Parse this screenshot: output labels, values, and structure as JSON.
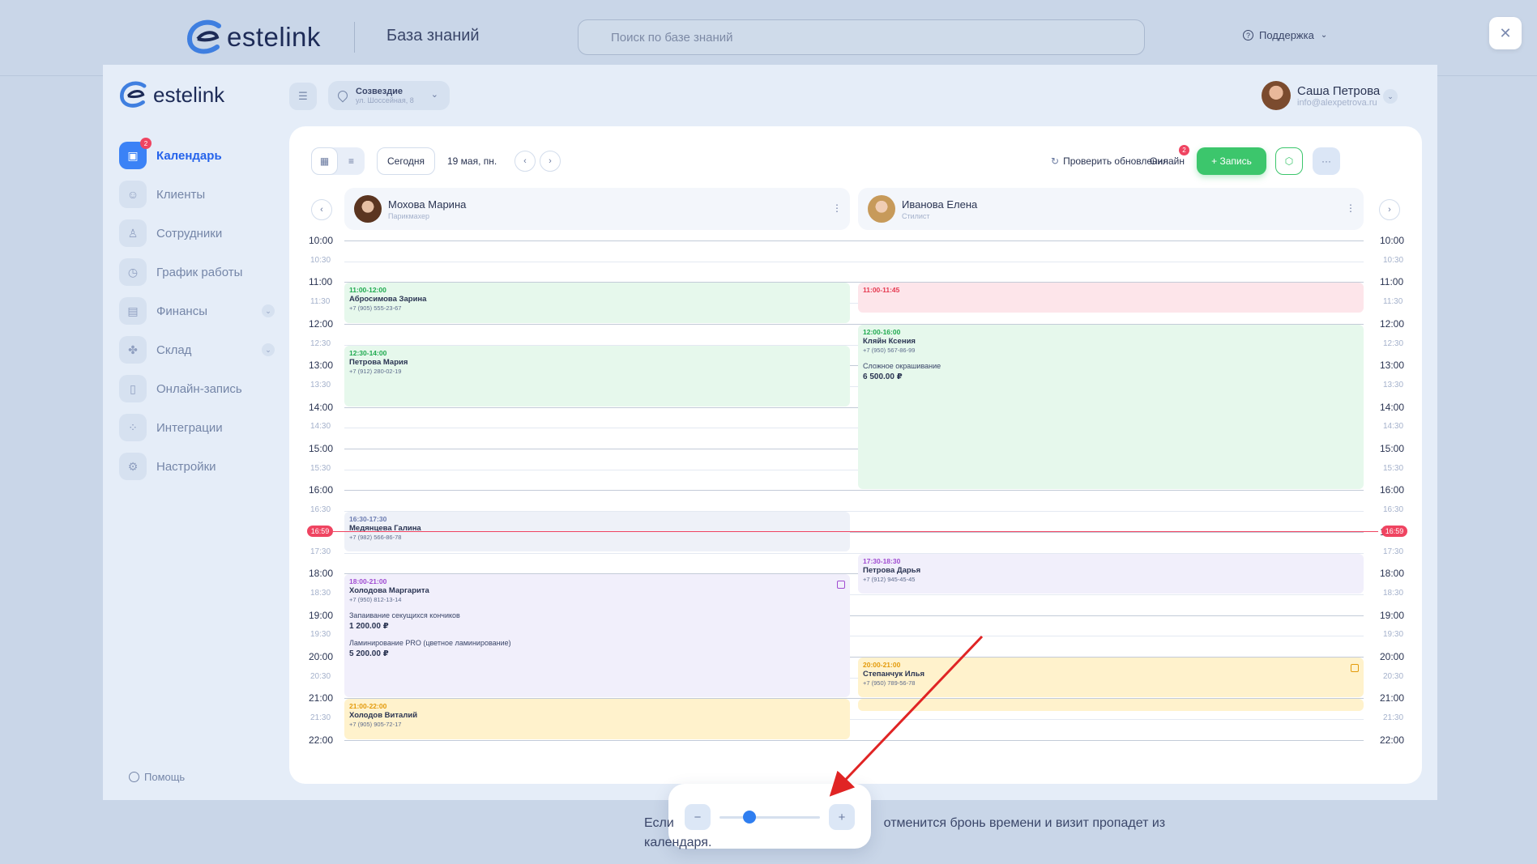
{
  "kb": {
    "logo_text": "estelink",
    "title": "База знаний",
    "search_placeholder": "Поиск по базе знаний",
    "support_label": "Поддержка",
    "close_icon": "close-icon"
  },
  "app": {
    "logo_text": "estelink",
    "branch": {
      "name": "Созвездие",
      "address": "ул. Шоссейная, 8"
    },
    "user": {
      "name": "Саша Петрова",
      "email": "info@alexpetrova.ru"
    },
    "nav": [
      {
        "label": "Календарь",
        "icon": "calendar-icon",
        "active": true,
        "badge": "2"
      },
      {
        "label": "Клиенты",
        "icon": "clients-icon"
      },
      {
        "label": "Сотрудники",
        "icon": "staff-icon"
      },
      {
        "label": "График работы",
        "icon": "clock-icon"
      },
      {
        "label": "Финансы",
        "icon": "wallet-icon",
        "expandable": true
      },
      {
        "label": "Склад",
        "icon": "warehouse-icon",
        "expandable": true
      },
      {
        "label": "Онлайн-запись",
        "icon": "phone-icon"
      },
      {
        "label": "Интеграции",
        "icon": "integrations-icon"
      },
      {
        "label": "Настройки",
        "icon": "settings-icon"
      }
    ],
    "help_label": "Помощь"
  },
  "toolbar": {
    "today_label": "Сегодня",
    "date_label": "19 мая, пн.",
    "check_updates_label": "Проверить обновления",
    "online_label": "Онлайн",
    "online_badge": "2",
    "add_label": "+ Запись"
  },
  "masters": [
    {
      "name": "Мохова Марина",
      "role": "Парикмахер"
    },
    {
      "name": "Иванова Елена",
      "role": "Стилист"
    }
  ],
  "times": [
    "10:00",
    "10:30",
    "11:00",
    "11:30",
    "12:00",
    "12:30",
    "13:00",
    "13:30",
    "14:00",
    "14:30",
    "15:00",
    "15:30",
    "16:00",
    "16:30",
    "17:00",
    "17:30",
    "18:00",
    "18:30",
    "19:00",
    "19:30",
    "20:00",
    "20:30",
    "21:00",
    "21:30",
    "22:00"
  ],
  "now": {
    "label": "16:59",
    "value": 16.983
  },
  "events": [
    {
      "col": 0,
      "start": 11.0,
      "end": 12.0,
      "color": "green",
      "time": "11:00-12:00",
      "client": "Абросимова Зарина",
      "phone": "+7 (905) 555-23-67"
    },
    {
      "col": 0,
      "start": 12.5,
      "end": 14.0,
      "color": "green",
      "time": "12:30-14:00",
      "client": "Петрова Мария",
      "phone": "+7 (912) 280-02-19"
    },
    {
      "col": 0,
      "start": 16.5,
      "end": 17.5,
      "color": "gray",
      "time": "16:30-17:30",
      "client": "Медянцева Галина",
      "phone": "+7 (982) 566-86-78"
    },
    {
      "col": 0,
      "start": 18.0,
      "end": 21.0,
      "color": "purple",
      "time": "18:00-21:00",
      "client": "Холодова Маргарита",
      "phone": "+7 (950) 812-13-14",
      "cash": true,
      "services": [
        {
          "name": "Запаивание секущихся кончиков",
          "price": "1 200.00 ₽"
        },
        {
          "name": "Ламинирование PRO (цветное ламинирование)",
          "price": "5 200.00 ₽"
        }
      ]
    },
    {
      "col": 0,
      "start": 21.0,
      "end": 22.0,
      "color": "yellow",
      "time": "21:00-22:00",
      "client": "Холодов Виталий",
      "phone": "+7 (905) 905-72-17"
    },
    {
      "col": 1,
      "start": 11.0,
      "end": 11.75,
      "color": "red",
      "time": "11:00-11:45",
      "client": "",
      "phone": ""
    },
    {
      "col": 1,
      "start": 12.0,
      "end": 16.0,
      "color": "green",
      "time": "12:00-16:00",
      "client": "Кляйн Ксения",
      "phone": "+7 (950) 567-86-99",
      "services": [
        {
          "name": "Сложное окрашивание",
          "price": "6 500.00 ₽"
        }
      ]
    },
    {
      "col": 1,
      "start": 17.5,
      "end": 18.5,
      "color": "purple",
      "time": "17:30-18:30",
      "client": "Петрова Дарья",
      "phone": "+7 (912) 945-45-45"
    },
    {
      "col": 1,
      "start": 20.0,
      "end": 21.0,
      "color": "yellow",
      "time": "20:00-21:00",
      "client": "Степанчук Илья",
      "phone": "+7 (950) 789-56-78",
      "cash": true
    },
    {
      "col": 1,
      "start": 21.0,
      "end": 21.33,
      "color": "yellow",
      "time": "",
      "client": "",
      "phone": ""
    }
  ],
  "zoom": {
    "minus": "−",
    "plus": "+",
    "level": 0.3
  },
  "caption": {
    "part1": "Если",
    "part2": "отменится бронь времени и визит пропадет из",
    "part3": "календаря."
  }
}
